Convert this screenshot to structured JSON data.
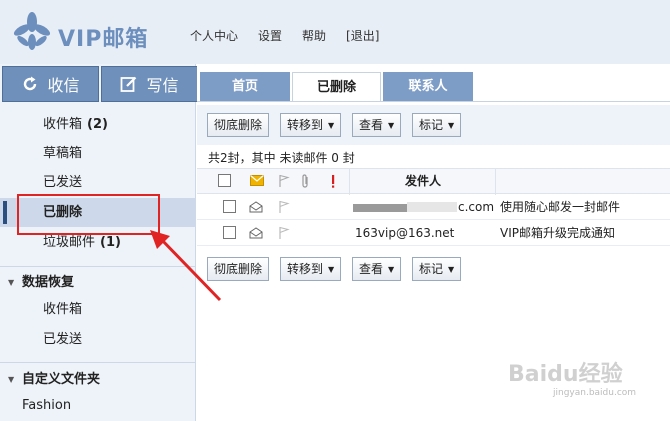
{
  "header": {
    "logo_text": "VIP邮箱",
    "nav": [
      "个人中心",
      "设置",
      "帮助",
      "[退出]"
    ]
  },
  "sidebar": {
    "receive_label": "收信",
    "compose_label": "写信",
    "folders": [
      {
        "label": "收件箱",
        "count": "(2)"
      },
      {
        "label": "草稿箱",
        "count": ""
      },
      {
        "label": "已发送",
        "count": ""
      },
      {
        "label": "已删除",
        "count": ""
      },
      {
        "label": "垃圾邮件",
        "count": "(1)"
      }
    ],
    "recovery_title": "数据恢复",
    "recovery_items": [
      "收件箱",
      "已发送"
    ],
    "custom_title": "自定义文件夹",
    "custom_items": [
      "Fashion"
    ]
  },
  "tabs": [
    "首页",
    "已删除",
    "联系人"
  ],
  "toolbar": {
    "delete_forever": "彻底删除",
    "move_to": "转移到",
    "view": "查看",
    "mark": "标记"
  },
  "summary": "共2封，其中 未读邮件 0 封",
  "table": {
    "header_sender": "发件人",
    "rows": [
      {
        "sender": "c.com",
        "subject": "使用随心邮发一封邮件"
      },
      {
        "sender": "163vip@163.net",
        "subject": "VIP邮箱升级完成通知"
      }
    ]
  },
  "watermark": {
    "text": "Baidu经验",
    "sub": "jingyan.baidu.com"
  },
  "colors": {
    "accent": "#6f90ba",
    "tab_inactive": "#7d9cc6",
    "highlight": "#e02424",
    "flag_yellow": "#f0b400",
    "important_red": "#d81e1e"
  }
}
